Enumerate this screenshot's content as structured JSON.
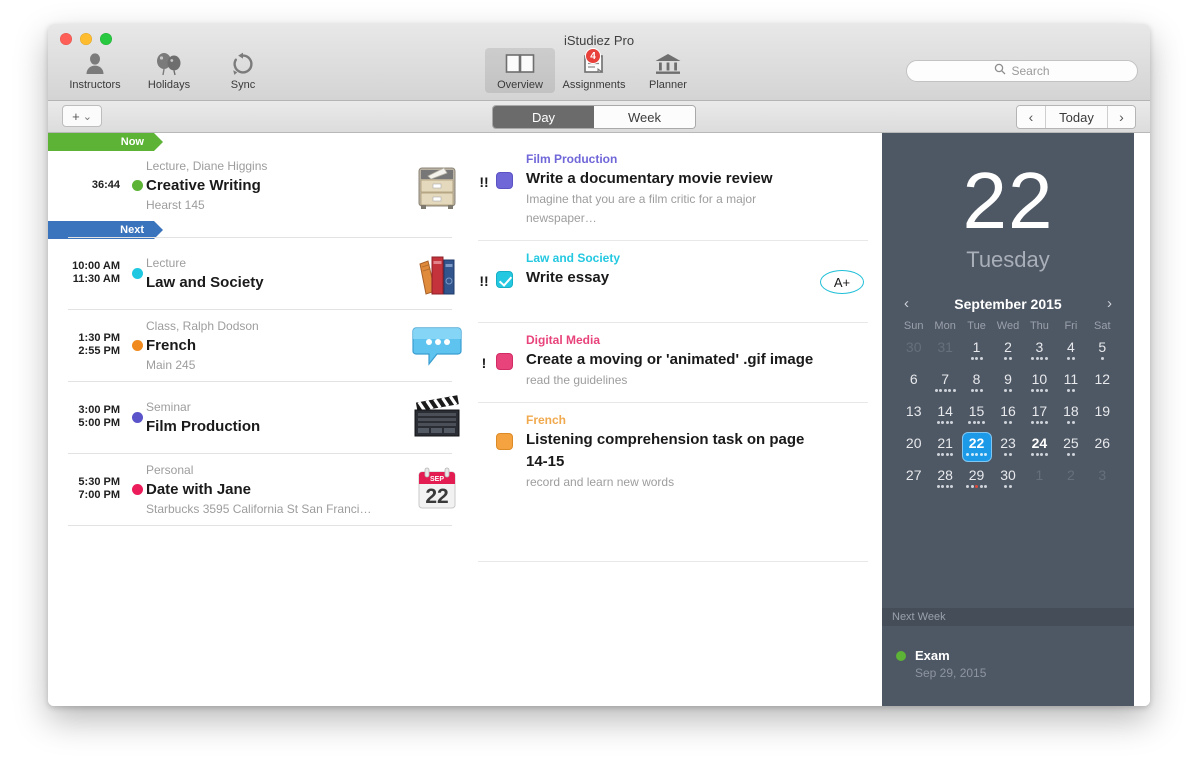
{
  "window": {
    "title": "iStudiez Pro"
  },
  "toolbar": {
    "left_items": [
      {
        "label": "Instructors",
        "icon": "person-icon"
      },
      {
        "label": "Holidays",
        "icon": "balloons-icon"
      },
      {
        "label": "Sync",
        "icon": "sync-icon"
      }
    ],
    "center_items": [
      {
        "label": "Overview",
        "icon": "book-open-icon",
        "selected": true,
        "badge": ""
      },
      {
        "label": "Assignments",
        "icon": "assignments-icon",
        "selected": false,
        "badge": "4"
      },
      {
        "label": "Planner",
        "icon": "bank-icon",
        "selected": false,
        "badge": ""
      }
    ],
    "search": {
      "placeholder": "Search",
      "value": "",
      "icon": "search-icon"
    }
  },
  "subbar": {
    "add_label": "+",
    "add_caret": "⌄",
    "segments": [
      {
        "label": "Day",
        "active": true
      },
      {
        "label": "Week",
        "active": false
      }
    ],
    "nav": {
      "prev": "‹",
      "today": "Today",
      "next": "›"
    }
  },
  "schedule": {
    "flags": [
      {
        "label": "Now",
        "color": "#5cb335"
      },
      {
        "label": "Next",
        "color": "#3a74bc"
      }
    ],
    "events": [
      {
        "time_start": "36:44",
        "time_end": "",
        "kind": "Lecture, Diane Higgins",
        "title": "Creative Writing",
        "place": "Hearst 145",
        "dot_color": "#5cb335",
        "art": "file-cabinet-icon"
      },
      {
        "time_start": "10:00 AM",
        "time_end": "11:30 AM",
        "kind": "Lecture",
        "title": "Law and Society",
        "place": "",
        "dot_color": "#1fc8e0",
        "art": "books-icon"
      },
      {
        "time_start": "1:30 PM",
        "time_end": "2:55 PM",
        "kind": "Class, Ralph Dodson",
        "title": "French",
        "place": "Main 245",
        "dot_color": "#f08a1e",
        "art": "speech-bubble-icon"
      },
      {
        "time_start": "3:00 PM",
        "time_end": "5:00 PM",
        "kind": "Seminar",
        "title": "Film Production",
        "place": "",
        "dot_color": "#5a53c9",
        "art": "clapperboard-icon"
      },
      {
        "time_start": "5:30 PM",
        "time_end": "7:00 PM",
        "kind": "Personal",
        "title": "Date with Jane",
        "place": "Starbucks 3595 California St San Franci…",
        "dot_color": "#ec1c5b",
        "art": "calendar-22-icon"
      }
    ]
  },
  "assignments": {
    "items": [
      {
        "priority": "!!",
        "course": "Film Production",
        "course_color": "#6f66d8",
        "title": "Write a documentary movie review",
        "note": "Imagine that you are a film critic for a major newspaper…",
        "box_color": "#6f66d8",
        "checked": false,
        "grade": ""
      },
      {
        "priority": "!!",
        "course": "Law and Society",
        "course_color": "#24c8e0",
        "title": "Write essay",
        "note": "",
        "box_color": "#24c8e0",
        "checked": true,
        "grade": "A+"
      },
      {
        "priority": "!",
        "course": "Digital Media",
        "course_color": "#e8437a",
        "title": "Create a moving or 'animated' .gif image",
        "note": "read the guidelines",
        "box_color": "#e8437a",
        "checked": false,
        "grade": ""
      },
      {
        "priority": "",
        "course": "French",
        "course_color": "#f1a94e",
        "title": "Listening comprehension task on page 14-15",
        "note": "record and learn new words",
        "box_color": "#f5a340",
        "checked": false,
        "grade": ""
      }
    ]
  },
  "sidebar": {
    "day_number": "22",
    "day_name": "Tuesday",
    "calendar": {
      "month_label": "September 2015",
      "prev_icon": "chevron-left-icon",
      "next_icon": "chevron-right-icon",
      "dow": [
        "Sun",
        "Mon",
        "Tue",
        "Wed",
        "Thu",
        "Fri",
        "Sat"
      ],
      "cells": [
        {
          "n": "30",
          "dim": true,
          "dots": 0
        },
        {
          "n": "31",
          "dim": true,
          "dots": 0
        },
        {
          "n": "1",
          "dim": false,
          "dots": 3
        },
        {
          "n": "2",
          "dim": false,
          "dots": 2
        },
        {
          "n": "3",
          "dim": false,
          "dots": 4
        },
        {
          "n": "4",
          "dim": false,
          "dots": 2
        },
        {
          "n": "5",
          "dim": false,
          "dots": 1
        },
        {
          "n": "6",
          "dim": false,
          "dots": 0
        },
        {
          "n": "7",
          "dim": false,
          "dots": 5
        },
        {
          "n": "8",
          "dim": false,
          "dots": 3
        },
        {
          "n": "9",
          "dim": false,
          "dots": 2
        },
        {
          "n": "10",
          "dim": false,
          "dots": 4
        },
        {
          "n": "11",
          "dim": false,
          "dots": 2
        },
        {
          "n": "12",
          "dim": false,
          "dots": 0
        },
        {
          "n": "13",
          "dim": false,
          "dots": 0
        },
        {
          "n": "14",
          "dim": false,
          "dots": 4
        },
        {
          "n": "15",
          "dim": false,
          "dots": 4
        },
        {
          "n": "16",
          "dim": false,
          "dots": 2
        },
        {
          "n": "17",
          "dim": false,
          "dots": 4
        },
        {
          "n": "18",
          "dim": false,
          "dots": 2
        },
        {
          "n": "19",
          "dim": false,
          "dots": 0
        },
        {
          "n": "20",
          "dim": false,
          "dots": 0
        },
        {
          "n": "21",
          "dim": false,
          "dots": 4
        },
        {
          "n": "22",
          "dim": false,
          "dots": 5,
          "today": true
        },
        {
          "n": "23",
          "dim": false,
          "dots": 2
        },
        {
          "n": "24",
          "dim": false,
          "dots": 4,
          "bold": true
        },
        {
          "n": "25",
          "dim": false,
          "dots": 2
        },
        {
          "n": "26",
          "dim": false,
          "dots": 0
        },
        {
          "n": "27",
          "dim": false,
          "dots": 0
        },
        {
          "n": "28",
          "dim": false,
          "dots": 4
        },
        {
          "n": "29",
          "dim": false,
          "dots": 5,
          "red_dot_index": 2
        },
        {
          "n": "30",
          "dim": false,
          "dots": 2
        },
        {
          "n": "1",
          "dim": true,
          "dots": 0
        },
        {
          "n": "2",
          "dim": true,
          "dots": 0
        },
        {
          "n": "3",
          "dim": true,
          "dots": 0
        }
      ]
    },
    "next_week": {
      "header": "Next Week",
      "items": [
        {
          "title": "Exam",
          "date": "Sep 29, 2015",
          "dot_color": "#5cb335"
        }
      ]
    }
  }
}
